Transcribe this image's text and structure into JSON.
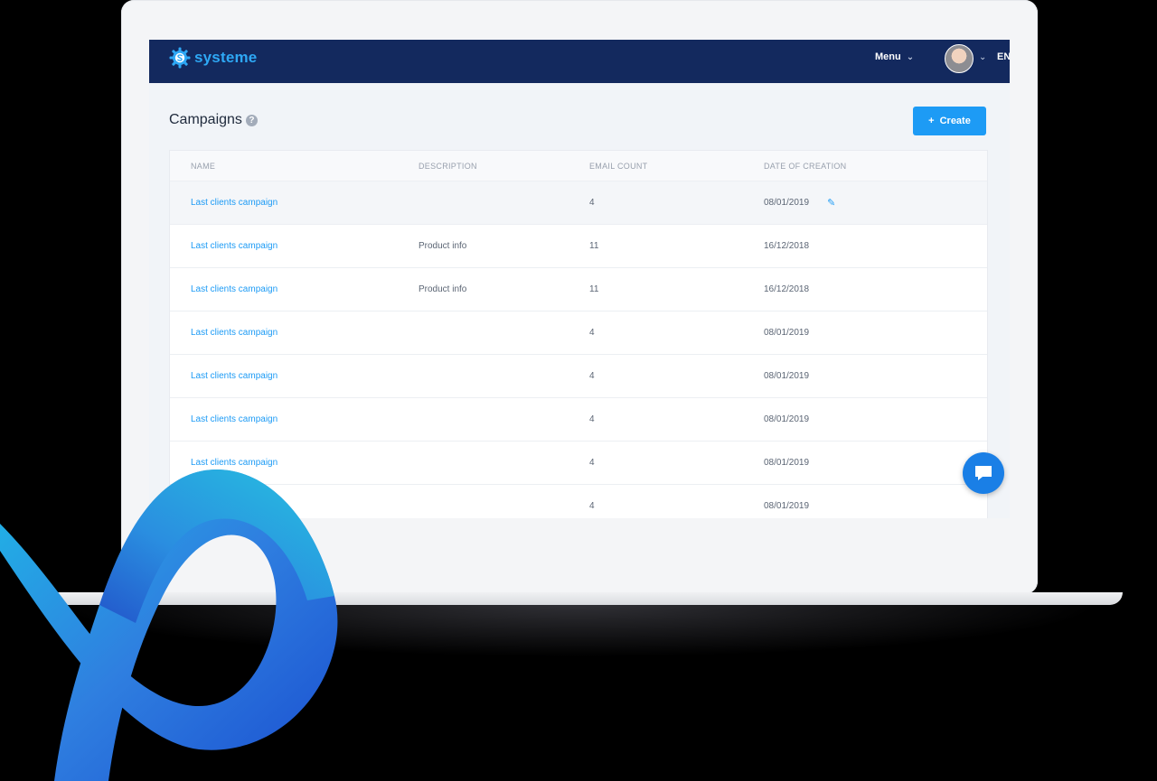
{
  "brand": {
    "name": "systeme",
    "color": "#2ea8f5",
    "header_bg": "#13295e"
  },
  "header": {
    "menu_label": "Menu",
    "lang_label": "EN"
  },
  "page": {
    "title": "Campaigns",
    "help_glyph": "?",
    "create_label": "Create",
    "create_glyph": "+"
  },
  "table": {
    "columns": [
      "NAME",
      "DESCRIPTION",
      "EMAIL COUNT",
      "DATE OF CREATION"
    ],
    "rows": [
      {
        "name": "Last clients campaign",
        "description": "",
        "email_count": "4",
        "date": "08/01/2019"
      },
      {
        "name": "Last clients campaign",
        "description": "Product info",
        "email_count": "11",
        "date": "16/12/2018"
      },
      {
        "name": "Last clients campaign",
        "description": "Product info",
        "email_count": "11",
        "date": "16/12/2018"
      },
      {
        "name": "Last clients campaign",
        "description": "",
        "email_count": "4",
        "date": "08/01/2019"
      },
      {
        "name": "Last clients campaign",
        "description": "",
        "email_count": "4",
        "date": "08/01/2019"
      },
      {
        "name": "Last clients campaign",
        "description": "",
        "email_count": "4",
        "date": "08/01/2019"
      },
      {
        "name": "Last clients campaign",
        "description": "",
        "email_count": "4",
        "date": "08/01/2019"
      },
      {
        "name": "",
        "description": "",
        "email_count": "4",
        "date": "08/01/2019"
      }
    ]
  },
  "icons": {
    "edit": "pencil-icon",
    "chat": "chat-bubble-icon",
    "help": "question-circle-icon"
  },
  "accent": "#1d9bf5"
}
